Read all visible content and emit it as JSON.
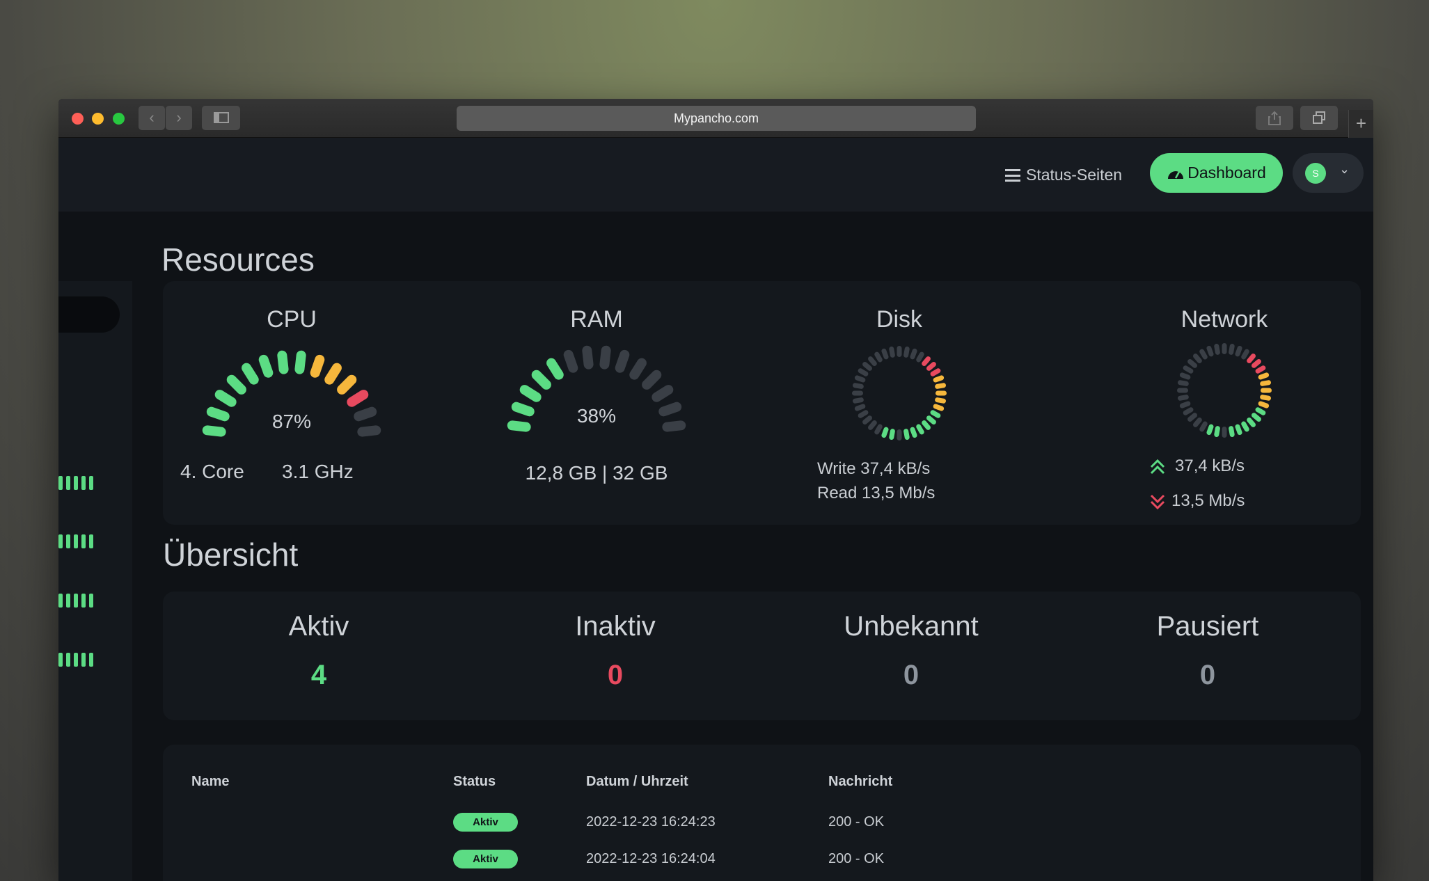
{
  "browser": {
    "url": "Mypancho.com",
    "new_tab": "+"
  },
  "nav": {
    "status_pages": "Status-Seiten",
    "dashboard": "Dashboard",
    "user_initial": "S"
  },
  "resources": {
    "title": "Resources",
    "cpu": {
      "title": "CPU",
      "percent": "87%",
      "percent_value": 87,
      "cores": "4. Core",
      "freq": "3.1 GHz"
    },
    "ram": {
      "title": "RAM",
      "percent": "38%",
      "percent_value": 38,
      "usage": "12,8 GB | 32 GB"
    },
    "disk": {
      "title": "Disk",
      "write": "Write 37,4 kB/s",
      "read": "Read 13,5 Mb/s"
    },
    "network": {
      "title": "Network",
      "up": "37,4 kB/s",
      "down": "13,5 Mb/s"
    }
  },
  "overview": {
    "title": "Übersicht",
    "items": [
      {
        "label": "Aktiv",
        "count": "4",
        "color": "#5cdc84"
      },
      {
        "label": "Inaktiv",
        "count": "0",
        "color": "#e84a5f"
      },
      {
        "label": "Unbekannt",
        "count": "0",
        "color": "#8e959e"
      },
      {
        "label": "Pausiert",
        "count": "0",
        "color": "#8e959e"
      }
    ]
  },
  "table": {
    "headers": {
      "name": "Name",
      "status": "Status",
      "datetime": "Datum / Uhrzeit",
      "message": "Nachricht"
    },
    "rows": [
      {
        "status": "Aktiv",
        "datetime": "2022-12-23 16:24:23",
        "message": "200 - OK"
      },
      {
        "status": "Aktiv",
        "datetime": "2022-12-23 16:24:04",
        "message": "200 - OK"
      }
    ]
  },
  "colors": {
    "accent": "#5cdc84",
    "danger": "#e84a5f",
    "warning": "#f6b73c",
    "panel": "#14181d",
    "background": "#0f1216"
  }
}
